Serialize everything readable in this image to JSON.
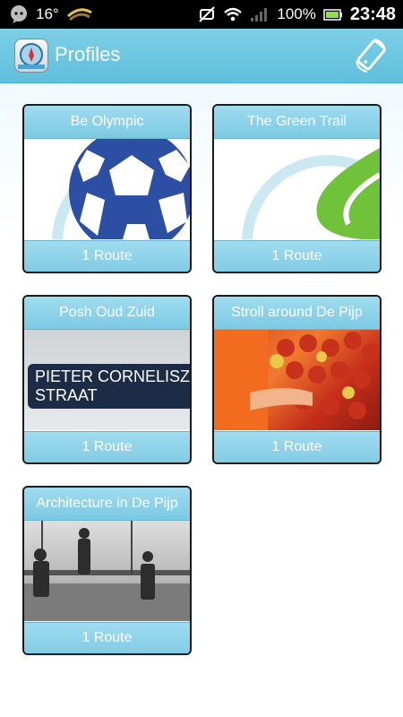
{
  "status_bar": {
    "temperature": "16°",
    "battery_percent": "100%",
    "time": "23:48",
    "icons": [
      "chat-icon",
      "weather-icon",
      "mute-icon",
      "wifi-icon",
      "signal-icon",
      "battery-icon"
    ]
  },
  "app_bar": {
    "title": "Profiles",
    "icons": [
      "app-logo-icon",
      "rotate-device-icon"
    ],
    "accent_color": "#6ec7e1"
  },
  "profiles": [
    {
      "title": "Be Olympic",
      "routes": "1 Route",
      "image": "handball-icon"
    },
    {
      "title": "The Green Trail",
      "routes": "1 Route",
      "image": "leaf-icon"
    },
    {
      "title": "Posh Oud Zuid",
      "routes": "1 Route",
      "image": "street-sign-photo",
      "sign_line1": "PIETER CORNELISZ",
      "sign_line2": "STRAAT"
    },
    {
      "title": "Stroll around De Pijp",
      "routes": "1 Route",
      "image": "market-apples-photo"
    },
    {
      "title": "Architecture in De Pijp",
      "routes": "1 Route",
      "image": "construction-workers-photo"
    }
  ]
}
